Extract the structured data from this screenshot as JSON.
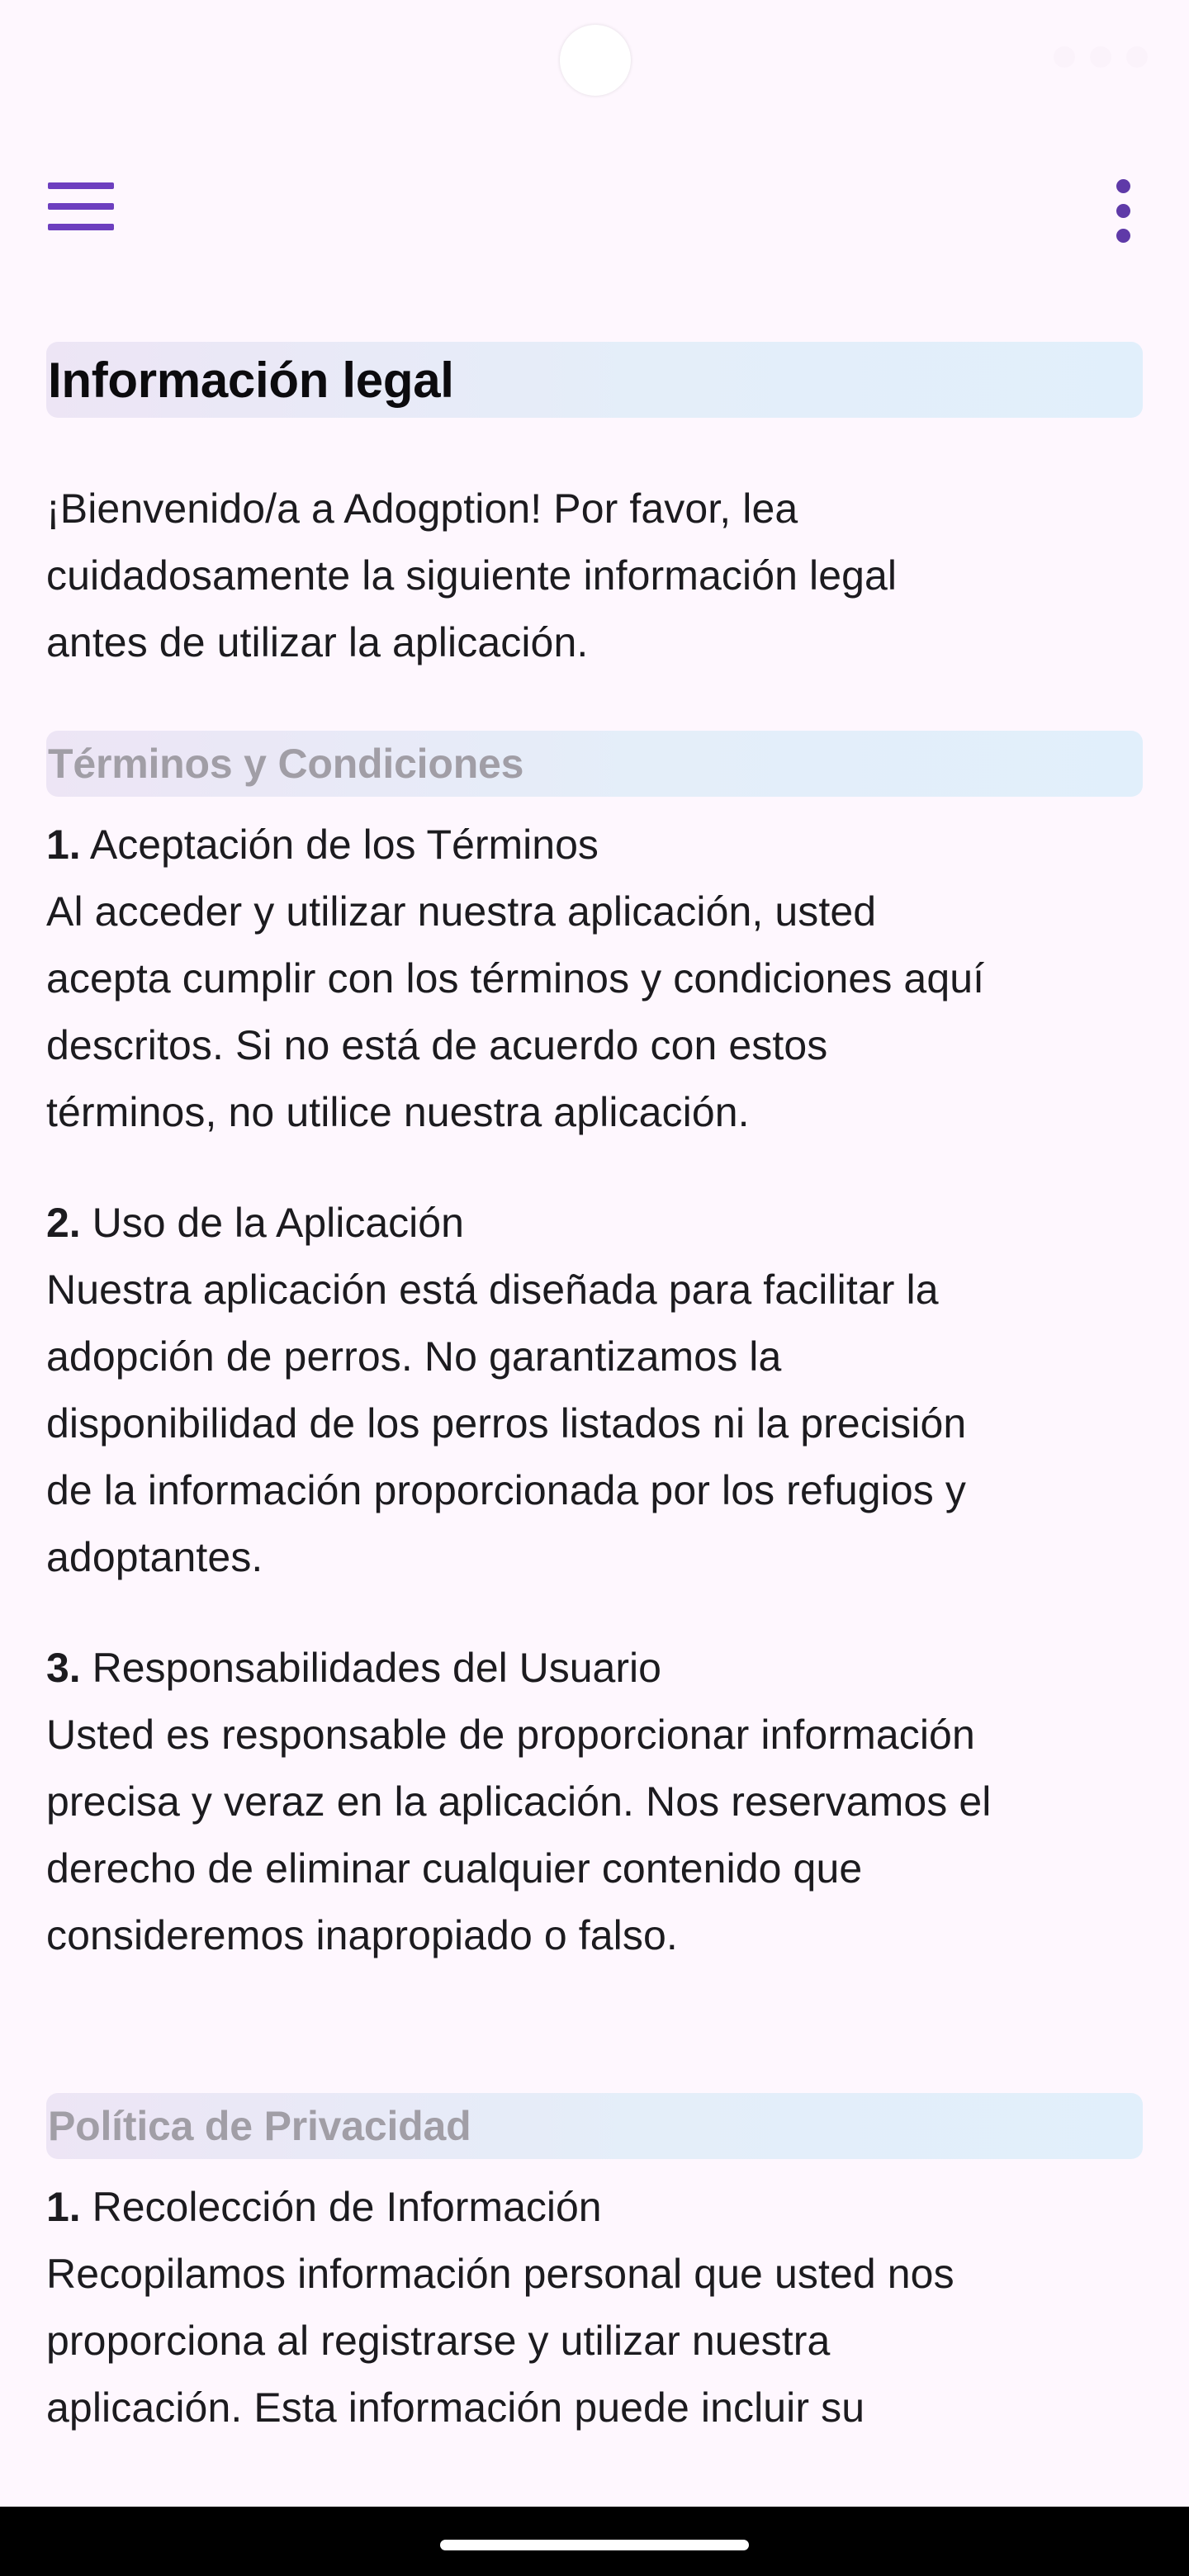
{
  "page": {
    "title": "Información legal",
    "intro": "¡Bienvenido/a a Adogption! Por favor, lea\ncuidadosamente la siguiente información legal\nantes de utilizar la aplicación."
  },
  "sections": {
    "terms": {
      "heading": "Términos y Condiciones",
      "items": [
        {
          "num": "1.",
          "title": "Aceptación de los Términos",
          "body": "Al acceder y utilizar nuestra aplicación, usted\nacepta cumplir con los términos y condiciones aquí\ndescritos. Si no está de acuerdo con estos\ntérminos, no utilice nuestra aplicación."
        },
        {
          "num": "2.",
          "title": "Uso de la Aplicación",
          "body": "Nuestra aplicación está diseñada para facilitar la\nadopción de perros. No garantizamos la\ndisponibilidad de los perros listados ni la precisión\nde la información proporcionada por los refugios y\nadoptantes."
        },
        {
          "num": "3.",
          "title": "Responsabilidades del Usuario",
          "body": "Usted es responsable de proporcionar información\nprecisa y veraz en la aplicación. Nos reservamos el\nderecho de eliminar cualquier contenido que\nconsideremos inapropiado o falso."
        }
      ]
    },
    "privacy": {
      "heading": "Política de Privacidad",
      "items": [
        {
          "num": "1.",
          "title": "Recolección de Información",
          "body": "Recopilamos información personal que usted nos\nproporciona al registrarse y utilizar nuestra\naplicación. Esta información puede incluir su"
        }
      ]
    }
  },
  "icons": {
    "menu": "menu-icon",
    "more": "more-vert-icon"
  },
  "colors": {
    "accent": "#6d3fbf",
    "background": "#fef7fe",
    "section_heading_text": "#a19ea6"
  }
}
